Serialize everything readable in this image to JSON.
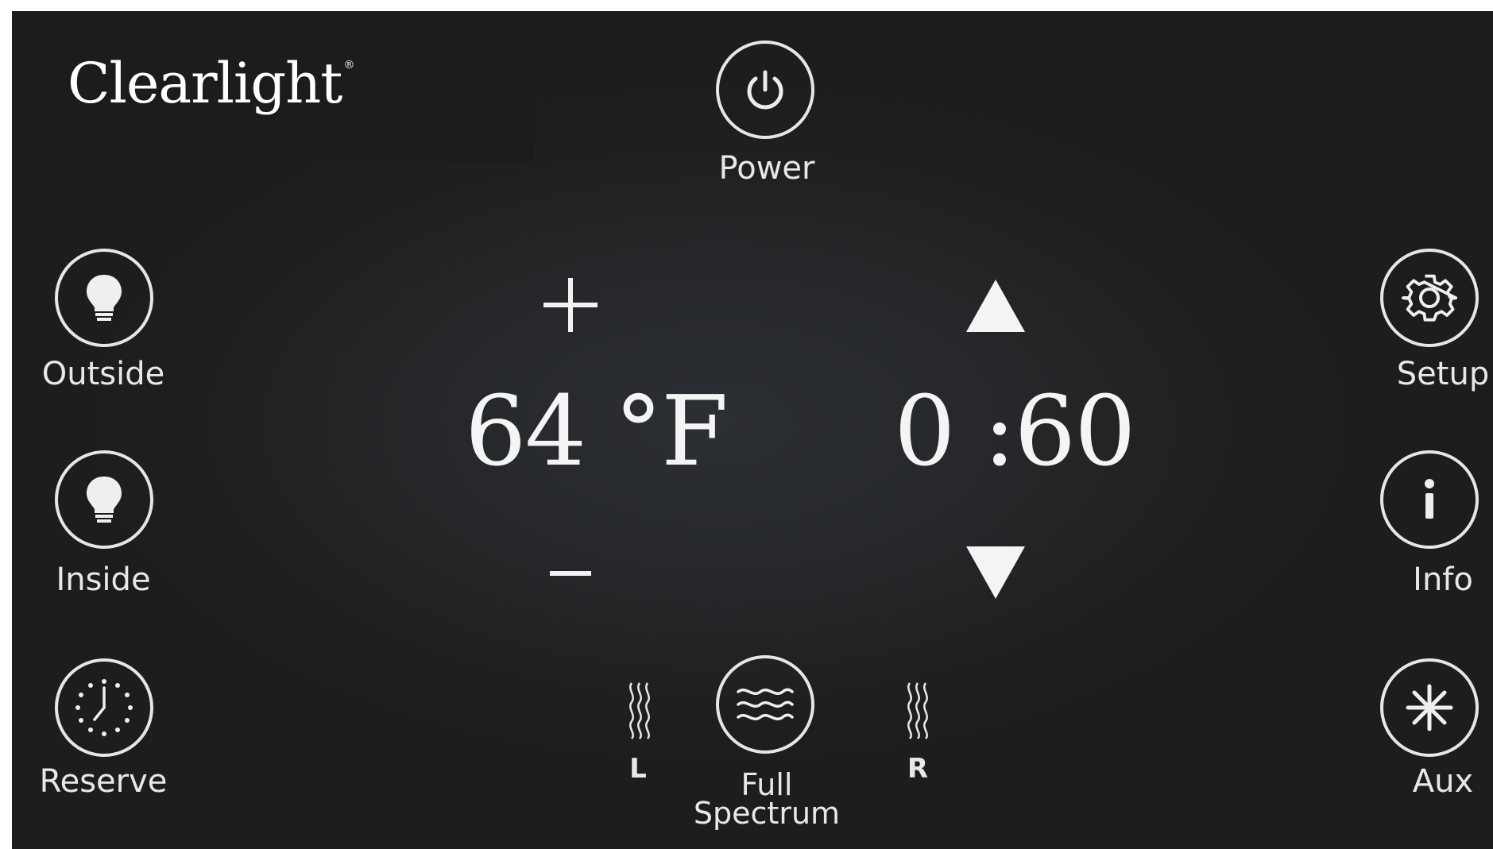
{
  "brand": {
    "name": "Clearlight",
    "mark": "®"
  },
  "power": {
    "label": "Power",
    "icon": "power-icon"
  },
  "left_buttons": [
    {
      "label": "Outside",
      "icon": "light-bulb-icon"
    },
    {
      "label": "Inside",
      "icon": "light-bulb-icon"
    },
    {
      "label": "Reserve",
      "icon": "clock-icon"
    }
  ],
  "right_buttons": [
    {
      "label": "Setup",
      "icon": "gear-icon"
    },
    {
      "label": "Info",
      "icon": "info-icon"
    },
    {
      "label": "Aux",
      "icon": "asterisk-icon"
    }
  ],
  "temperature": {
    "value": "64 °F",
    "increase": "+",
    "decrease": "−"
  },
  "timer": {
    "value": "0 :60",
    "up_icon": "triangle-up-icon",
    "down_icon": "triangle-down-icon"
  },
  "heaters": {
    "left_label": "L",
    "right_label": "R",
    "full_spectrum_label_line1": "Full",
    "full_spectrum_label_line2": "Spectrum",
    "heat_icon": "heat-waves-icon",
    "full_spectrum_icon": "waves-icon"
  },
  "colors": {
    "background": "#1f1f1f",
    "foreground": "#f2f2f2"
  }
}
